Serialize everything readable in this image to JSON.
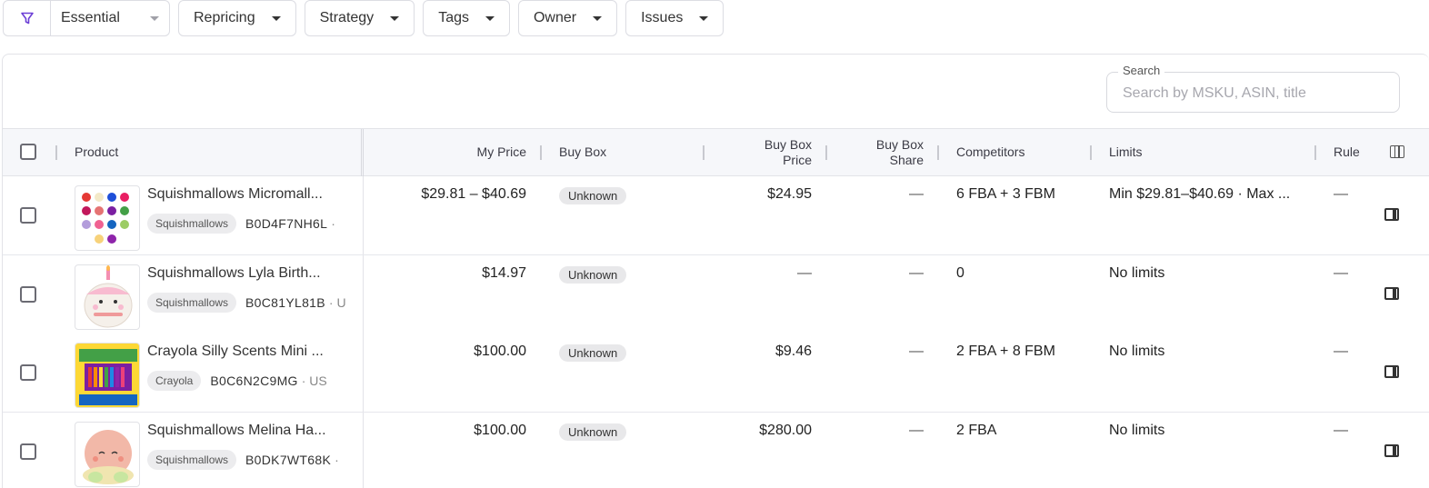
{
  "filters": {
    "view": "Essential",
    "buttons": [
      "Repricing",
      "Strategy",
      "Tags",
      "Owner",
      "Issues"
    ]
  },
  "search": {
    "label": "Search",
    "placeholder": "Search by MSKU, ASIN, title"
  },
  "table": {
    "columns": {
      "product": "Product",
      "my_price": "My Price",
      "buy_box": "Buy Box",
      "buy_box_price_1": "Buy Box",
      "buy_box_price_2": "Price",
      "buy_box_share_1": "Buy Box",
      "buy_box_share_2": "Share",
      "competitors": "Competitors",
      "limits": "Limits",
      "rule": "Rule"
    },
    "rows": [
      {
        "title": "Squishmallows Micromall...",
        "brand": "Squishmallows",
        "asin": "B0D4F7NH6L",
        "marketplace": "·",
        "my_price": "$29.81 – $40.69",
        "buy_box": "Unknown",
        "buy_box_price": "$24.95",
        "buy_box_share": "—",
        "competitors": "6 FBA + 3 FBM",
        "limits": "Min $29.81–$40.69 · Max ...",
        "rule": "—"
      },
      {
        "title": "Squishmallows Lyla Birth...",
        "brand": "Squishmallows",
        "asin": "B0C81YL81B",
        "marketplace": "· U",
        "my_price": "$14.97",
        "buy_box": "Unknown",
        "buy_box_price": "—",
        "buy_box_share": "—",
        "competitors": "0",
        "limits": "No limits",
        "rule": "—"
      },
      {
        "title": "Crayola Silly Scents Mini ...",
        "brand": "Crayola",
        "asin": "B0C6N2C9MG",
        "marketplace": "· US",
        "my_price": "$100.00",
        "buy_box": "Unknown",
        "buy_box_price": "$9.46",
        "buy_box_share": "—",
        "competitors": "2 FBA + 8 FBM",
        "limits": "No limits",
        "rule": "—"
      },
      {
        "title": "Squishmallows Melina Ha...",
        "brand": "Squishmallows",
        "asin": "B0DK7WT68K",
        "marketplace": "·",
        "my_price": "$100.00",
        "buy_box": "Unknown",
        "buy_box_price": "$280.00",
        "buy_box_share": "—",
        "competitors": "2 FBA",
        "limits": "No limits",
        "rule": "—"
      }
    ]
  },
  "colors": {
    "accent": "#6c3fd6",
    "header_bg": "#f6f7fa",
    "badge_bg": "#e8e8ea"
  }
}
